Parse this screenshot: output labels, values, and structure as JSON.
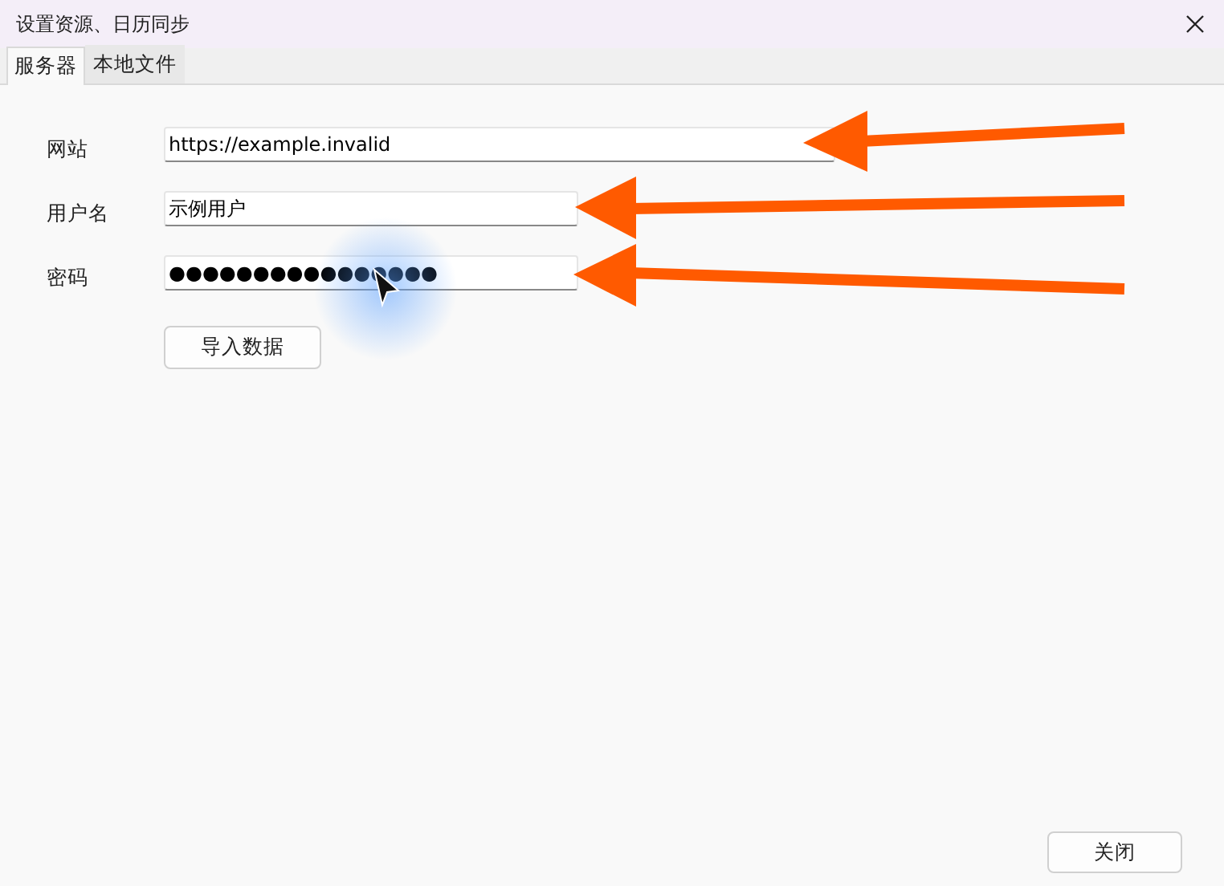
{
  "window": {
    "title": "设置资源、日历同步"
  },
  "tabs": [
    {
      "label": "服务器",
      "selected": true
    },
    {
      "label": "本地文件",
      "selected": false
    }
  ],
  "fields": [
    {
      "label": "网站",
      "value": "https://example.invalid",
      "kind": "wide"
    },
    {
      "label": "用户名",
      "value": "示例用户",
      "kind": "normal"
    },
    {
      "label": "密码",
      "value": "●●●●●●●●●●●●●●●●",
      "kind": "normal"
    }
  ],
  "import_button": "导入数据",
  "close_button": "关闭"
}
